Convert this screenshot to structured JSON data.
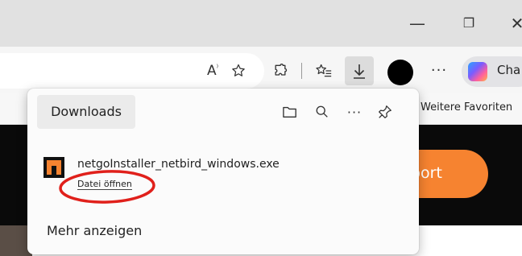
{
  "window": {
    "minimize_icon": "minimize-icon",
    "restore_icon": "restore-icon",
    "close_icon": "close-icon"
  },
  "toolbar": {
    "read_aloud_label": "A",
    "copilot_label": "Cha",
    "more_label": "···"
  },
  "favorites_bar": {
    "label": "Weitere Favoriten"
  },
  "page": {
    "button_label": "port",
    "accent": "#f68330"
  },
  "downloads": {
    "title": "Downloads",
    "more_label": "···",
    "items": [
      {
        "filename": "netgoInstaller_netbird_windows.exe",
        "action": "Datei öffnen"
      }
    ],
    "show_more": "Mehr anzeigen"
  },
  "annotation": {
    "color": "#e0201b"
  }
}
